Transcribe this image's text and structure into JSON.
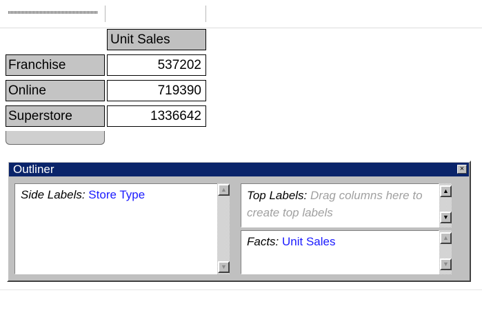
{
  "pivot": {
    "column_header": "Unit Sales",
    "rows": [
      {
        "label": "Franchise",
        "value": "537202"
      },
      {
        "label": "Online",
        "value": "719390"
      },
      {
        "label": "Superstore",
        "value": "1336642"
      }
    ]
  },
  "outliner": {
    "title": "Outliner",
    "close_glyph": "×",
    "side_labels": {
      "label": "Side Labels:",
      "value": "Store Type"
    },
    "top_labels": {
      "label": "Top Labels:",
      "hint": "Drag columns here to create top labels"
    },
    "facts": {
      "label": "Facts:",
      "value": "Unit Sales"
    }
  },
  "icons": {
    "up": "▲",
    "down": "▼"
  },
  "colors": {
    "titlebar": "#0a246a",
    "link": "#1a1aff",
    "hint": "#a0a0a0"
  }
}
